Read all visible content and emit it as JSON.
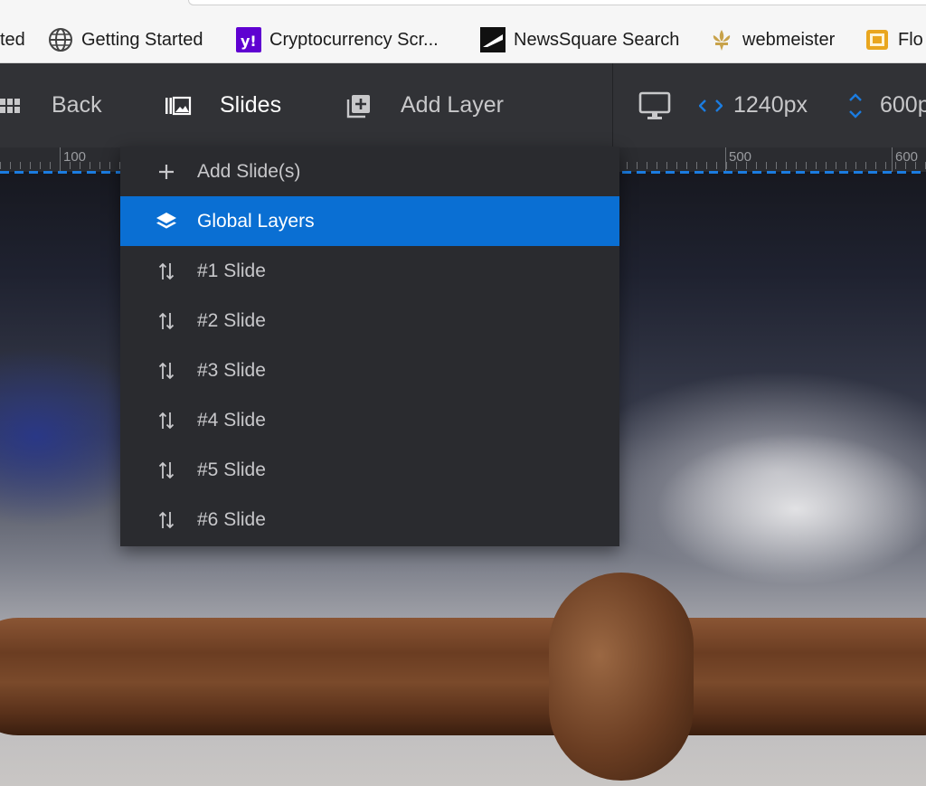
{
  "bookmarks": [
    {
      "label": "ted",
      "icon": "none"
    },
    {
      "label": "Getting Started",
      "icon": "globe-icon"
    },
    {
      "label": "Cryptocurrency Scr...",
      "icon": "yahoo-icon"
    },
    {
      "label": "NewsSquare Search",
      "icon": "newssquare-icon"
    },
    {
      "label": "webmeister",
      "icon": "fleur-de-lis-icon"
    },
    {
      "label": "Flo",
      "icon": "folder-icon"
    }
  ],
  "toolbar": {
    "back_label": "Back",
    "slides_label": "Slides",
    "add_layer_label": "Add Layer",
    "width_value": "1240px",
    "height_value": "600p"
  },
  "ruler": {
    "labels": [
      "100",
      "500",
      "600"
    ]
  },
  "dropdown": {
    "items": [
      {
        "label": "Add Slide(s)",
        "icon": "plus-icon",
        "active": false
      },
      {
        "label": "Global Layers",
        "icon": "layers-icon",
        "active": true
      },
      {
        "label": "#1 Slide",
        "icon": "sort-arrows-icon",
        "active": false
      },
      {
        "label": "#2 Slide",
        "icon": "sort-arrows-icon",
        "active": false
      },
      {
        "label": "#3 Slide",
        "icon": "sort-arrows-icon",
        "active": false
      },
      {
        "label": "#4 Slide",
        "icon": "sort-arrows-icon",
        "active": false
      },
      {
        "label": "#5 Slide",
        "icon": "sort-arrows-icon",
        "active": false
      },
      {
        "label": "#6 Slide",
        "icon": "sort-arrows-icon",
        "active": false
      }
    ]
  },
  "colors": {
    "accent": "#0a6fd3",
    "toolbar_bg": "#313236",
    "dropdown_bg": "#2a2b2f",
    "guide_line": "#1b7ce0"
  }
}
